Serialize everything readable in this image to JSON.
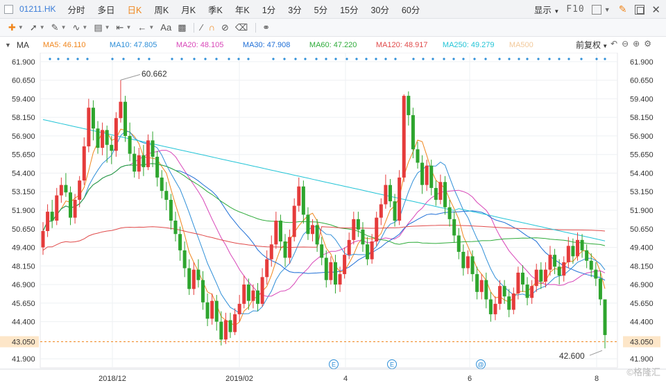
{
  "toolbar": {
    "symbol": "01211.HK",
    "periods": [
      "分时",
      "多日",
      "日K",
      "周K",
      "月K",
      "季K",
      "年K",
      "1分",
      "3分",
      "5分",
      "15分",
      "30分",
      "60分"
    ],
    "active_period": "日K",
    "display_label": "显示",
    "f10_label": "F10"
  },
  "drawing_tools": [
    "crosshair-icon",
    "line-icon",
    "channel-icon",
    "wave-icon",
    "fib-icon",
    "range-icon",
    "arrow-icon",
    "text-icon",
    "note-icon",
    "ruler-icon",
    "magnet-icon",
    "hide-icon",
    "delete-icon",
    "link-icon"
  ],
  "indicators": {
    "name": "MA",
    "items": [
      {
        "label": "MA5: 46.110",
        "color": "#f0861d"
      },
      {
        "label": "MA10: 47.805",
        "color": "#2f8fd8"
      },
      {
        "label": "MA20: 48.105",
        "color": "#d846b8"
      },
      {
        "label": "MA30: 47.908",
        "color": "#1f6fd6"
      },
      {
        "label": "MA60: 47.220",
        "color": "#2eab3a"
      },
      {
        "label": "MA120: 48.917",
        "color": "#e04a4a"
      },
      {
        "label": "MA250: 49.279",
        "color": "#22c4d6"
      },
      {
        "label": "MA500",
        "color": "#f2c99a"
      }
    ],
    "adjust_label": "前复权"
  },
  "colors": {
    "up": "#e53b3b",
    "down": "#2ea52e",
    "current": "#f0861d"
  },
  "chart_data": {
    "type": "candlestick",
    "y_ticks": [
      "61.900",
      "60.650",
      "59.400",
      "58.150",
      "56.900",
      "55.650",
      "54.400",
      "53.150",
      "51.900",
      "50.650",
      "49.400",
      "48.150",
      "46.900",
      "45.650",
      "44.400",
      "43.050",
      "41.900"
    ],
    "ylim": [
      41.3,
      62.5
    ],
    "x_labels": [
      "2018/12",
      "2019/02",
      "4",
      "6",
      "8"
    ],
    "high_annotation": "60.662",
    "low_annotation": "42.600",
    "current_price": "43.050",
    "event_markers": [
      "E",
      "E",
      "@"
    ],
    "watermark": "©格隆汇",
    "candles": [
      [
        49.4,
        50.5,
        51.1,
        48.9
      ],
      [
        50.5,
        51.8,
        52.3,
        50.1
      ],
      [
        51.8,
        51.2,
        52.6,
        50.7
      ],
      [
        51.2,
        52.9,
        53.4,
        50.9
      ],
      [
        52.9,
        53.6,
        54.1,
        52.4
      ],
      [
        53.6,
        53.1,
        54.4,
        52.8
      ],
      [
        53.1,
        51.4,
        53.5,
        50.9
      ],
      [
        51.4,
        52.6,
        53.0,
        51.0
      ],
      [
        52.6,
        53.9,
        54.2,
        52.1
      ],
      [
        53.9,
        56.2,
        56.8,
        53.6
      ],
      [
        56.2,
        58.8,
        59.4,
        55.8
      ],
      [
        58.8,
        57.4,
        59.3,
        56.6
      ],
      [
        57.4,
        56.1,
        57.9,
        55.7
      ],
      [
        56.1,
        57.3,
        57.8,
        55.6
      ],
      [
        57.3,
        56.3,
        57.6,
        55.1
      ],
      [
        56.3,
        55.9,
        56.9,
        55.0
      ],
      [
        55.9,
        58.1,
        58.5,
        55.5
      ],
      [
        58.1,
        59.2,
        60.66,
        57.8
      ],
      [
        59.2,
        56.9,
        59.6,
        56.5
      ],
      [
        56.9,
        55.7,
        57.8,
        55.2
      ],
      [
        55.7,
        54.5,
        56.2,
        54.1
      ],
      [
        54.5,
        55.6,
        56.1,
        54.0
      ],
      [
        55.6,
        54.8,
        56.3,
        54.2
      ],
      [
        54.8,
        56.6,
        57.0,
        54.6
      ],
      [
        56.6,
        55.5,
        57.2,
        54.8
      ],
      [
        55.5,
        54.1,
        55.9,
        53.5
      ],
      [
        54.1,
        53.2,
        54.6,
        52.7
      ],
      [
        53.2,
        52.6,
        53.8,
        51.9
      ],
      [
        52.6,
        51.2,
        53.0,
        50.6
      ],
      [
        51.2,
        50.3,
        51.8,
        49.8
      ],
      [
        50.3,
        49.2,
        50.8,
        48.5
      ],
      [
        49.2,
        48.0,
        49.8,
        47.4
      ],
      [
        48.0,
        46.6,
        48.6,
        46.2
      ],
      [
        46.6,
        47.9,
        48.4,
        46.2
      ],
      [
        47.9,
        47.2,
        48.6,
        46.7
      ],
      [
        47.2,
        45.7,
        47.8,
        45.2
      ],
      [
        45.7,
        44.6,
        46.3,
        44.1
      ],
      [
        44.6,
        45.8,
        46.3,
        44.2
      ],
      [
        45.8,
        44.4,
        46.2,
        43.8
      ],
      [
        44.4,
        43.2,
        45.1,
        42.8
      ],
      [
        43.2,
        44.5,
        45.0,
        42.9
      ],
      [
        44.5,
        43.7,
        45.0,
        43.3
      ],
      [
        43.7,
        44.9,
        45.3,
        43.5
      ],
      [
        44.9,
        45.6,
        46.2,
        44.4
      ],
      [
        45.6,
        46.9,
        47.5,
        45.3
      ],
      [
        46.9,
        45.8,
        47.3,
        45.2
      ],
      [
        45.8,
        46.5,
        46.9,
        45.3
      ],
      [
        46.5,
        45.6,
        47.0,
        45.1
      ],
      [
        45.6,
        47.4,
        48.0,
        45.4
      ],
      [
        47.4,
        48.6,
        49.2,
        46.9
      ],
      [
        48.6,
        49.6,
        50.2,
        48.1
      ],
      [
        49.6,
        51.2,
        51.8,
        49.3
      ],
      [
        51.2,
        49.8,
        51.6,
        49.2
      ],
      [
        49.8,
        48.7,
        50.3,
        48.1
      ],
      [
        48.7,
        50.1,
        50.6,
        48.3
      ],
      [
        50.1,
        52.2,
        52.7,
        49.8
      ],
      [
        52.2,
        53.5,
        54.1,
        51.8
      ],
      [
        53.5,
        51.6,
        53.9,
        51.0
      ],
      [
        51.6,
        50.3,
        52.1,
        49.9
      ],
      [
        50.3,
        50.9,
        51.3,
        49.8
      ],
      [
        50.9,
        49.6,
        51.3,
        49.1
      ],
      [
        49.6,
        48.7,
        50.1,
        48.2
      ],
      [
        48.7,
        47.2,
        49.2,
        46.7
      ],
      [
        47.2,
        48.4,
        48.8,
        46.9
      ],
      [
        48.4,
        46.9,
        48.9,
        46.3
      ],
      [
        46.9,
        47.6,
        48.1,
        46.4
      ],
      [
        47.6,
        48.9,
        49.4,
        47.3
      ],
      [
        48.9,
        49.9,
        50.4,
        48.6
      ],
      [
        49.9,
        51.3,
        51.8,
        49.6
      ],
      [
        51.3,
        50.6,
        51.8,
        50.1
      ],
      [
        50.6,
        49.6,
        51.1,
        49.1
      ],
      [
        49.6,
        48.6,
        50.1,
        48.2
      ],
      [
        48.6,
        49.8,
        50.3,
        48.3
      ],
      [
        49.8,
        51.4,
        51.8,
        49.5
      ],
      [
        51.4,
        52.3,
        52.7,
        50.9
      ],
      [
        52.3,
        53.6,
        54.3,
        52.0
      ],
      [
        53.6,
        52.5,
        54.0,
        52.1
      ],
      [
        52.5,
        51.2,
        53.0,
        50.8
      ],
      [
        51.2,
        54.1,
        54.6,
        50.9
      ],
      [
        54.1,
        59.6,
        59.7,
        53.8
      ],
      [
        59.6,
        58.3,
        59.9,
        57.6
      ],
      [
        58.3,
        56.0,
        58.8,
        55.4
      ],
      [
        56.0,
        55.1,
        56.5,
        54.7
      ],
      [
        55.1,
        53.6,
        55.6,
        53.0
      ],
      [
        53.6,
        54.9,
        55.3,
        53.2
      ],
      [
        54.9,
        53.4,
        55.3,
        52.9
      ],
      [
        53.4,
        52.6,
        53.9,
        52.2
      ],
      [
        52.6,
        53.8,
        54.3,
        52.3
      ],
      [
        53.8,
        52.1,
        54.2,
        51.6
      ],
      [
        52.1,
        51.3,
        52.6,
        50.8
      ],
      [
        51.3,
        50.2,
        51.8,
        49.7
      ],
      [
        50.2,
        49.1,
        50.7,
        48.6
      ],
      [
        49.1,
        48.0,
        49.6,
        47.5
      ],
      [
        48.0,
        48.8,
        49.2,
        47.6
      ],
      [
        48.8,
        47.6,
        49.2,
        47.1
      ],
      [
        47.6,
        46.4,
        48.1,
        45.9
      ],
      [
        46.4,
        47.2,
        47.6,
        45.9
      ],
      [
        47.2,
        45.9,
        47.7,
        45.3
      ],
      [
        45.9,
        44.9,
        46.4,
        44.4
      ],
      [
        44.9,
        45.6,
        46.1,
        44.5
      ],
      [
        45.6,
        46.8,
        47.2,
        45.2
      ],
      [
        46.8,
        46.1,
        47.2,
        45.6
      ],
      [
        46.1,
        45.2,
        46.6,
        44.7
      ],
      [
        45.2,
        46.3,
        46.7,
        44.9
      ],
      [
        46.3,
        47.7,
        48.1,
        45.9
      ],
      [
        47.7,
        46.9,
        48.2,
        46.4
      ],
      [
        46.9,
        46.0,
        47.4,
        45.5
      ],
      [
        46.0,
        46.8,
        47.2,
        45.6
      ],
      [
        46.8,
        47.9,
        48.3,
        46.4
      ],
      [
        47.9,
        47.1,
        48.4,
        46.6
      ],
      [
        47.1,
        47.9,
        48.4,
        46.7
      ],
      [
        47.9,
        48.9,
        49.5,
        47.5
      ],
      [
        48.9,
        48.1,
        49.3,
        47.6
      ],
      [
        48.1,
        47.5,
        48.6,
        46.9
      ],
      [
        47.5,
        48.4,
        48.8,
        47.1
      ],
      [
        48.4,
        49.5,
        50.1,
        48.0
      ],
      [
        49.5,
        48.8,
        50.0,
        48.3
      ],
      [
        48.8,
        49.9,
        50.4,
        48.5
      ],
      [
        49.9,
        49.2,
        50.3,
        48.7
      ],
      [
        49.2,
        48.5,
        49.6,
        48.0
      ],
      [
        48.5,
        47.9,
        49.0,
        47.4
      ],
      [
        47.9,
        47.3,
        48.4,
        46.8
      ],
      [
        47.3,
        45.9,
        47.8,
        45.5
      ],
      [
        45.9,
        43.5,
        44.8,
        42.6
      ]
    ]
  }
}
